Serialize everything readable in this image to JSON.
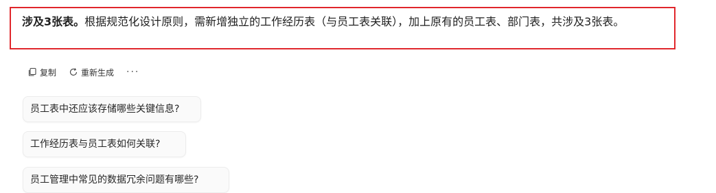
{
  "answer": {
    "bold_text": "涉及3张表。",
    "text": "根据规范化设计原则，需新增独立的工作经历表（与员工表关联），加上原有的员工表、部门表，共涉及3张表。"
  },
  "actions": {
    "copy_label": "复制",
    "regenerate_label": "重新生成",
    "more_label": "···"
  },
  "suggestions": [
    "员工表中还应该存储哪些关键信息?",
    "工作经历表与员工表如何关联?",
    "员工管理中常见的数据冗余问题有哪些?"
  ],
  "colors": {
    "highlight_border": "#e0262b",
    "chip_background": "#fafafa"
  }
}
